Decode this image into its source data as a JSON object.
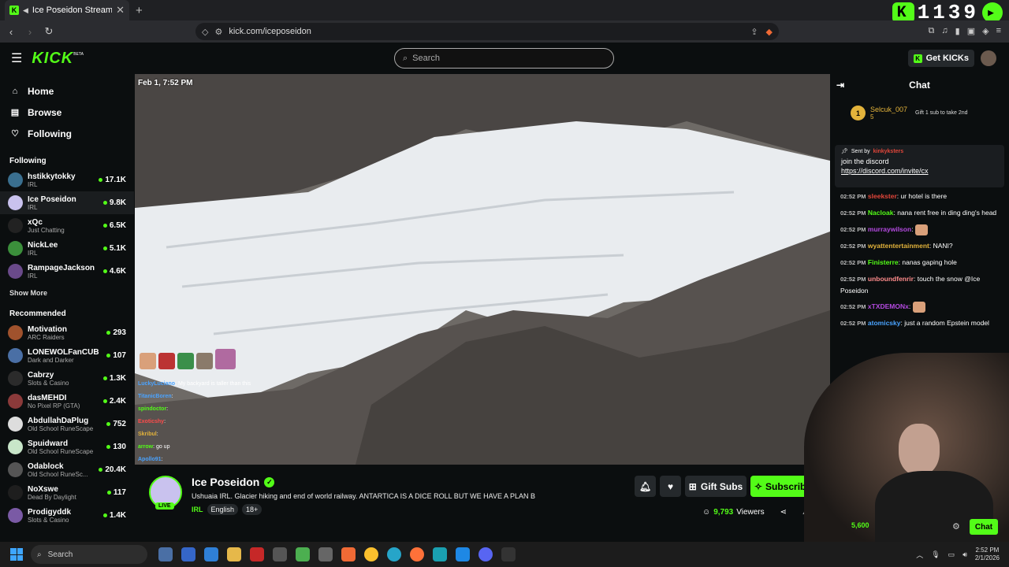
{
  "browser": {
    "tab_title": "Ice Poseidon Stream - Watch",
    "url": "kick.com/iceposeidon",
    "overlay_counter": "1139"
  },
  "header": {
    "logo": "KICK",
    "logo_badge": "BETA",
    "search_placeholder": "Search",
    "get_kicks_label": "Get KICKs"
  },
  "sidebar": {
    "nav": [
      {
        "label": "Home",
        "icon": "home-icon"
      },
      {
        "label": "Browse",
        "icon": "browse-icon"
      },
      {
        "label": "Following",
        "icon": "heart-icon"
      }
    ],
    "following_heading": "Following",
    "following": [
      {
        "name": "hstikkytokky",
        "category": "IRL",
        "viewers": "17.1K",
        "color": "#3a6f8f"
      },
      {
        "name": "Ice Poseidon",
        "category": "IRL",
        "viewers": "9.8K",
        "color": "#c9c2ee"
      },
      {
        "name": "xQc",
        "category": "Just Chatting",
        "viewers": "6.5K",
        "color": "#222222"
      },
      {
        "name": "NickLee",
        "category": "IRL",
        "viewers": "5.1K",
        "color": "#3b8f3b"
      },
      {
        "name": "RampageJackson",
        "category": "IRL",
        "viewers": "4.6K",
        "color": "#6a4a8a"
      }
    ],
    "show_more": "Show More",
    "recommended_heading": "Recommended",
    "recommended": [
      {
        "name": "Motivation",
        "category": "ARC Raiders",
        "viewers": "293",
        "color": "#a0522d"
      },
      {
        "name": "LONEWOLFanCUB",
        "category": "Dark and Darker",
        "viewers": "107",
        "color": "#4a6fa5"
      },
      {
        "name": "Cabrzy",
        "category": "Slots & Casino",
        "viewers": "1.3K",
        "color": "#2b2b2b"
      },
      {
        "name": "dasMEHDI",
        "category": "No Pixel RP (GTA)",
        "viewers": "2.4K",
        "color": "#8b3a3a"
      },
      {
        "name": "AbdullahDaPlug",
        "category": "Old School RuneScape",
        "viewers": "752",
        "color": "#dddddd"
      },
      {
        "name": "Spuidward",
        "category": "Old School RuneScape",
        "viewers": "130",
        "color": "#c8e6c9"
      },
      {
        "name": "Odablock",
        "category": "Old School RuneSc...",
        "viewers": "20.4K",
        "color": "#555555"
      },
      {
        "name": "NoXswe",
        "category": "Dead By Daylight",
        "viewers": "117",
        "color": "#1e1e1e"
      },
      {
        "name": "Prodigyddk",
        "category": "Slots & Casino",
        "viewers": "1.4K",
        "color": "#7a5aa5"
      }
    ]
  },
  "video": {
    "timestamp": "Feb 1, 7:52 PM",
    "overlay_chat": [
      {
        "user": "LuckyLuciano",
        "text": "My backyard is taller than this",
        "color": "#4aa3ff"
      },
      {
        "user": "TitanicBoren",
        "text": "",
        "color": "#4aa3ff"
      },
      {
        "user": "spindoctor",
        "text": "",
        "color": "#53fc18"
      },
      {
        "user": "Exoticshy",
        "text": "",
        "color": "#ff4b4b"
      },
      {
        "user": "Skribul",
        "text": "",
        "color": "#e3b33b"
      },
      {
        "user": "arrow",
        "text": "go up",
        "color": "#53fc18"
      },
      {
        "user": "Apollo91",
        "text": "",
        "color": "#4aa3ff"
      }
    ]
  },
  "stream": {
    "name": "Ice Poseidon",
    "live": "LIVE",
    "title": "Ushuaia IRL. Glacier hiking and end of world railway. ANTARTICA IS A DICE ROLL BUT WE HAVE A PLAN B",
    "category": "IRL",
    "tags": [
      "English",
      "18+"
    ],
    "gift_label": "Gift Subs",
    "subscribe_label": "Subscribe",
    "viewers": "9,793",
    "viewers_label": "Viewers"
  },
  "chat": {
    "heading": "Chat",
    "gifter": {
      "rank": "1",
      "name": "Selcuk_007",
      "count": "5",
      "prompt": "Gift 1 sub to take 2nd"
    },
    "pinned": {
      "sent_by": "Sent by",
      "user": "kinkyksters",
      "line1": "join the discord",
      "line2": "https://discord.com/invite/cx"
    },
    "messages": [
      {
        "time": "02:52 PM",
        "user": "sleekster",
        "text": ": ur hotel is there",
        "color": "#e2463a"
      },
      {
        "time": "02:52 PM",
        "user": "Nacloak",
        "text": ": nana rent free in ding ding's head",
        "color": "#53fc18"
      },
      {
        "time": "02:52 PM",
        "user": "murraywilson",
        "text": ":",
        "color": "#b44ae0"
      },
      {
        "time": "02:52 PM",
        "user": "wyattentertainment",
        "text": ": NANI?",
        "color": "#e3b33b"
      },
      {
        "time": "02:52 PM",
        "user": "Finisterre",
        "text": ": nanas gaping hole",
        "color": "#53fc18"
      },
      {
        "time": "02:52 PM",
        "user": "unboundfenrir",
        "text": ": touch the snow @Ice Poseidon",
        "color": "#ff8c8c"
      },
      {
        "time": "02:52 PM",
        "user": "xTXDEMONx",
        "text": ":",
        "color": "#b44ae0"
      },
      {
        "time": "02:52 PM",
        "user": "atomicsky",
        "text": ": just a random Epstein model",
        "color": "#4aa3ff"
      }
    ],
    "footer_count": "5,600",
    "chat_button": "Chat"
  },
  "taskbar": {
    "search": "Search",
    "time": "2:52 PM",
    "date": "2/1/2026"
  }
}
